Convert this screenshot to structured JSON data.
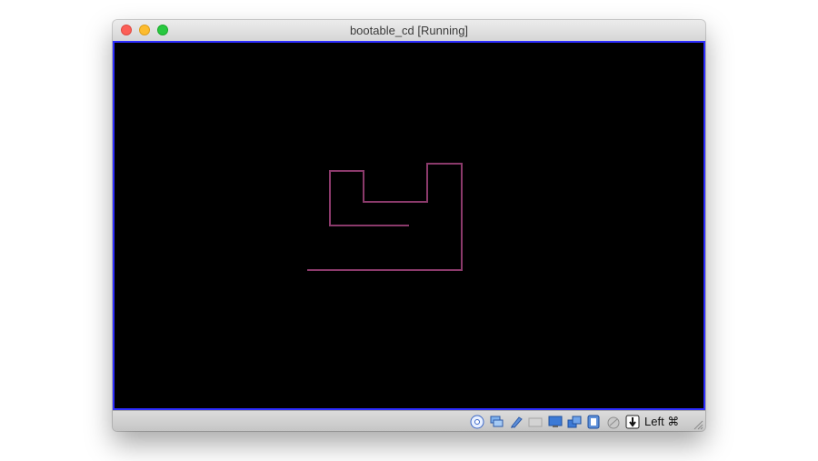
{
  "window": {
    "title": "bootable_cd [Running]"
  },
  "vm_screen": {
    "background": "#000000",
    "drawing_color": "#8b3a6b",
    "border_color": "#2e2eff"
  },
  "statusbar": {
    "icons": [
      "optical-drive-icon",
      "network-icon",
      "usb-icon",
      "shared-folders-icon",
      "display-icon",
      "video-capture-icon",
      "cpu-icon",
      "mouse-integration-icon",
      "keyboard-capture-icon"
    ],
    "host_key": "Left ⌘"
  }
}
